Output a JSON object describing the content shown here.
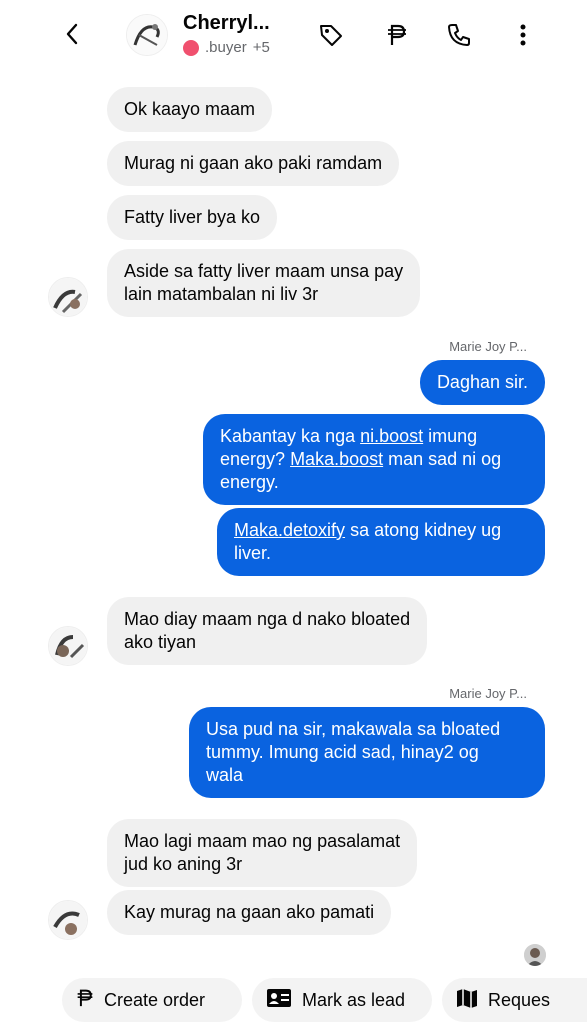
{
  "header": {
    "contact_name": "Cherryl...",
    "contact_tag": ".buyer",
    "contact_tag_extra": "+5",
    "icons": [
      "back-chevron-icon",
      "tag-icon",
      "peso-icon",
      "phone-icon",
      "more-vertical-icon"
    ]
  },
  "messages": {
    "in1": "Ok kaayo maam",
    "in2": "Murag ni gaan ako paki ramdam",
    "in3": "Fatty liver bya ko",
    "in4_l1": "Aside sa fatty liver maam unsa pay",
    "in4_l2": "lain matambalan ni liv 3r",
    "sender1": "Marie Joy P...",
    "out1": "Daghan sir.",
    "out2_a": "Kabantay ka nga ",
    "out2_link1": "ni.boost",
    "out2_b": " imung",
    "out2_c": "energy? ",
    "out2_link2": "Maka.boost",
    "out2_d": " man sad ni og",
    "out2_e": "energy.",
    "out3_link": "Maka.detoxify",
    "out3_a": " sa atong kidney ug",
    "out3_b": "liver.",
    "in5_l1": "Mao diay maam nga d nako bloated",
    "in5_l2": "ako tiyan",
    "sender2": "Marie Joy P...",
    "out4_l1": "Usa pud na sir, makawala sa bloated",
    "out4_l2": "tummy. Imung acid sad, hinay2 og",
    "out4_l3": "wala",
    "in6_l1": "Mao lagi maam mao ng pasalamat",
    "in6_l2": "jud ko aning 3r",
    "in7": "Kay murag na gaan ako pamati"
  },
  "actions": {
    "create_order": "Create order",
    "mark_as_lead": "Mark as lead",
    "request": "Reques"
  },
  "colors": {
    "outgoing_bubble": "#0a63e0",
    "incoming_bubble": "#f0f0f0",
    "status_dot": "#f0506e"
  }
}
